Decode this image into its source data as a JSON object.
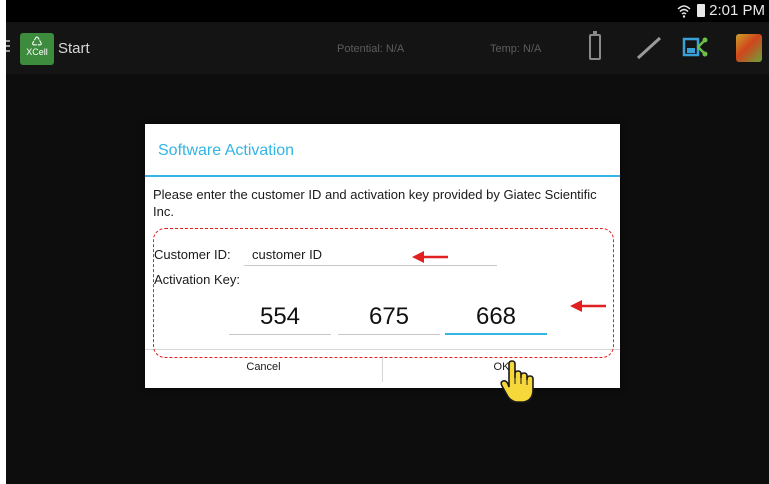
{
  "status_bar": {
    "time": "2:01 PM",
    "icons": [
      "wifi-icon",
      "battery-icon"
    ]
  },
  "action_bar": {
    "app_icon_label": "XCell",
    "title": "Start",
    "potential": "Potential: N/A",
    "temp": "Temp: N/A",
    "icons": [
      "menu-icon",
      "battery-outline-icon",
      "probe-icon",
      "network-icon",
      "map-icon"
    ]
  },
  "dialog": {
    "title": "Software Activation",
    "message": "Please enter the customer ID and activation key provided by Giatec Scientific Inc.",
    "customer_id_label": "Customer ID:",
    "customer_id_value": "customer ID",
    "activation_key_label": "Activation Key:",
    "key_parts": [
      "554",
      "675",
      "668"
    ],
    "cancel_label": "Cancel",
    "ok_label": "OK"
  },
  "colors": {
    "accent": "#33b5e5",
    "annotation": "#e02020",
    "background": "#0d0d0d"
  }
}
